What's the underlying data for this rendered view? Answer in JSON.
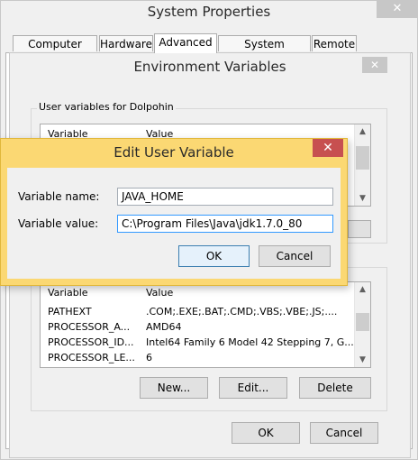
{
  "system_properties": {
    "title": "System Properties",
    "close_glyph": "✕",
    "tabs": [
      {
        "label": "Computer Name"
      },
      {
        "label": "Hardware"
      },
      {
        "label": "Advanced"
      },
      {
        "label": "System Protection"
      },
      {
        "label": "Remote"
      }
    ],
    "active_tab": "Advanced"
  },
  "env_vars": {
    "title": "Environment Variables",
    "close_glyph": "✕",
    "user_group_label": "User variables for Dolpohin",
    "user_list": {
      "headers": [
        "Variable",
        "Value"
      ]
    },
    "system_list": {
      "headers": [
        "Variable",
        "Value"
      ],
      "rows": [
        {
          "variable": "PATHEXT",
          "value": ".COM;.EXE;.BAT;.CMD;.VBS;.VBE;.JS;...."
        },
        {
          "variable": "PROCESSOR_A...",
          "value": "AMD64"
        },
        {
          "variable": "PROCESSOR_ID...",
          "value": "Intel64 Family 6 Model 42 Stepping 7, G..."
        },
        {
          "variable": "PROCESSOR_LE...",
          "value": "6"
        }
      ]
    },
    "buttons": {
      "new": "New...",
      "edit": "Edit...",
      "delete": "Delete"
    },
    "ok": "OK",
    "cancel": "Cancel"
  },
  "edit_dialog": {
    "title": "Edit User Variable",
    "close_glyph": "✕",
    "name_label": "Variable name:",
    "name_value": "JAVA_HOME",
    "value_label": "Variable value:",
    "value_value": "C:\\Program Files\\Java\\jdk1.7.0_80",
    "ok": "OK",
    "cancel": "Cancel"
  }
}
